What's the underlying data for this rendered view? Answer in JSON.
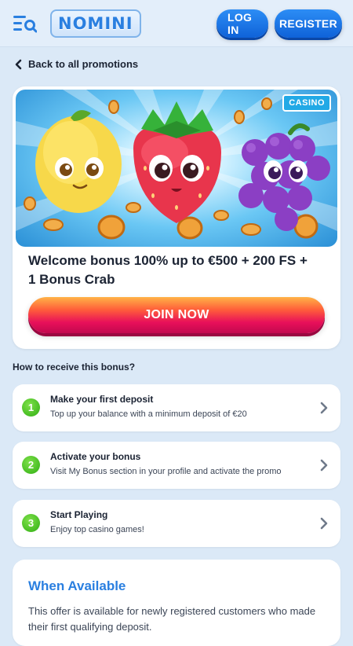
{
  "header": {
    "logo_text": "NOMINI",
    "login_label": "LOG IN",
    "register_label": "REGISTER"
  },
  "back": {
    "label": "Back to all promotions"
  },
  "promo": {
    "badge": "CASINO",
    "title": "Welcome bonus 100% up to €500 + 200 FS + 1 Bonus Crab",
    "cta": "JOIN NOW"
  },
  "howto": {
    "heading": "How to receive this bonus?"
  },
  "steps": [
    {
      "num": "1",
      "title": "Make your first deposit",
      "desc": "Top up your balance with a minimum deposit of €20"
    },
    {
      "num": "2",
      "title": "Activate your bonus",
      "desc": "Visit My Bonus section in your profile and activate the promo"
    },
    {
      "num": "3",
      "title": "Start Playing",
      "desc": "Enjoy top casino games!"
    }
  ],
  "availability": {
    "title": "When Available",
    "text": "This offer is available for newly registered customers who made their first qualifying deposit."
  },
  "colors": {
    "accent_blue": "#2a7fe0",
    "join_gradient_top": "#ff5e3a",
    "join_gradient_bottom": "#c2084e",
    "step_green": "#2fae12",
    "page_bg": "#dbe9f7"
  },
  "icons": [
    "menu-search-icon",
    "chevron-left-icon",
    "chevron-right-icon"
  ]
}
